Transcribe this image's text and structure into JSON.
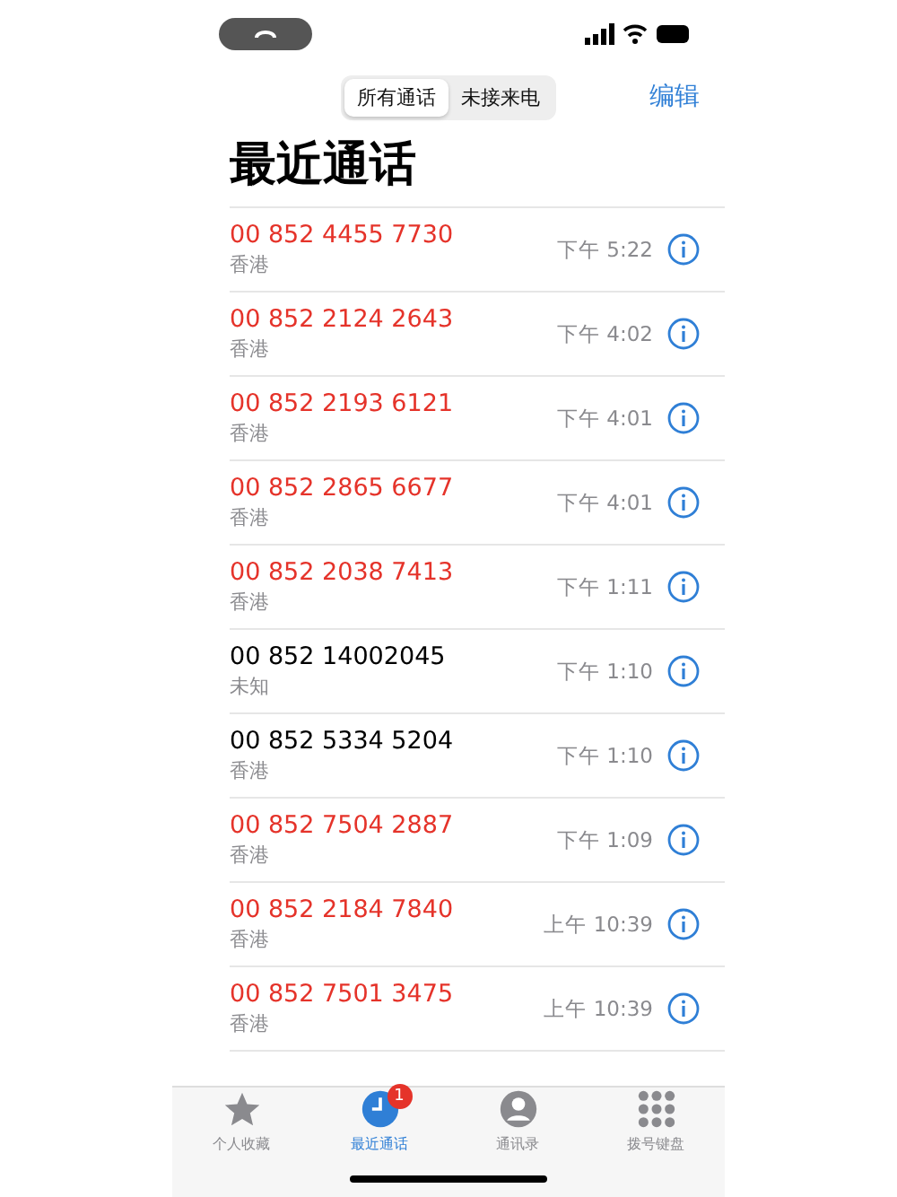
{
  "segments": [
    {
      "label": "所有通话",
      "selected": true
    },
    {
      "label": "未接来电",
      "selected": false
    }
  ],
  "edit_button": "编辑",
  "title": "最近通话",
  "calls": [
    {
      "number": "00 852 4455 7730",
      "location": "香港",
      "time": "下午 5:22",
      "missed": true
    },
    {
      "number": "00 852 2124 2643",
      "location": "香港",
      "time": "下午 4:02",
      "missed": true
    },
    {
      "number": "00 852 2193 6121",
      "location": "香港",
      "time": "下午 4:01",
      "missed": true
    },
    {
      "number": "00 852 2865 6677",
      "location": "香港",
      "time": "下午 4:01",
      "missed": true
    },
    {
      "number": "00 852 2038 7413",
      "location": "香港",
      "time": "下午 1:11",
      "missed": true
    },
    {
      "number": "00 852 14002045",
      "location": "未知",
      "time": "下午 1:10",
      "missed": false
    },
    {
      "number": "00 852 5334 5204",
      "location": "香港",
      "time": "下午 1:10",
      "missed": false
    },
    {
      "number": "00 852 7504 2887",
      "location": "香港",
      "time": "下午 1:09",
      "missed": true
    },
    {
      "number": "00 852 2184 7840",
      "location": "香港",
      "time": "上午 10:39",
      "missed": true
    },
    {
      "number": "00 852 7501 3475",
      "location": "香港",
      "time": "上午 10:39",
      "missed": true
    }
  ],
  "tab_bar": [
    {
      "kind": "star",
      "label": "个人收藏",
      "selected": false
    },
    {
      "kind": "clock",
      "label": "最近通话",
      "selected": true,
      "badge": "1"
    },
    {
      "kind": "person",
      "label": "通讯录",
      "selected": false
    },
    {
      "kind": "keypad",
      "label": "拨号键盘",
      "selected": false
    }
  ]
}
